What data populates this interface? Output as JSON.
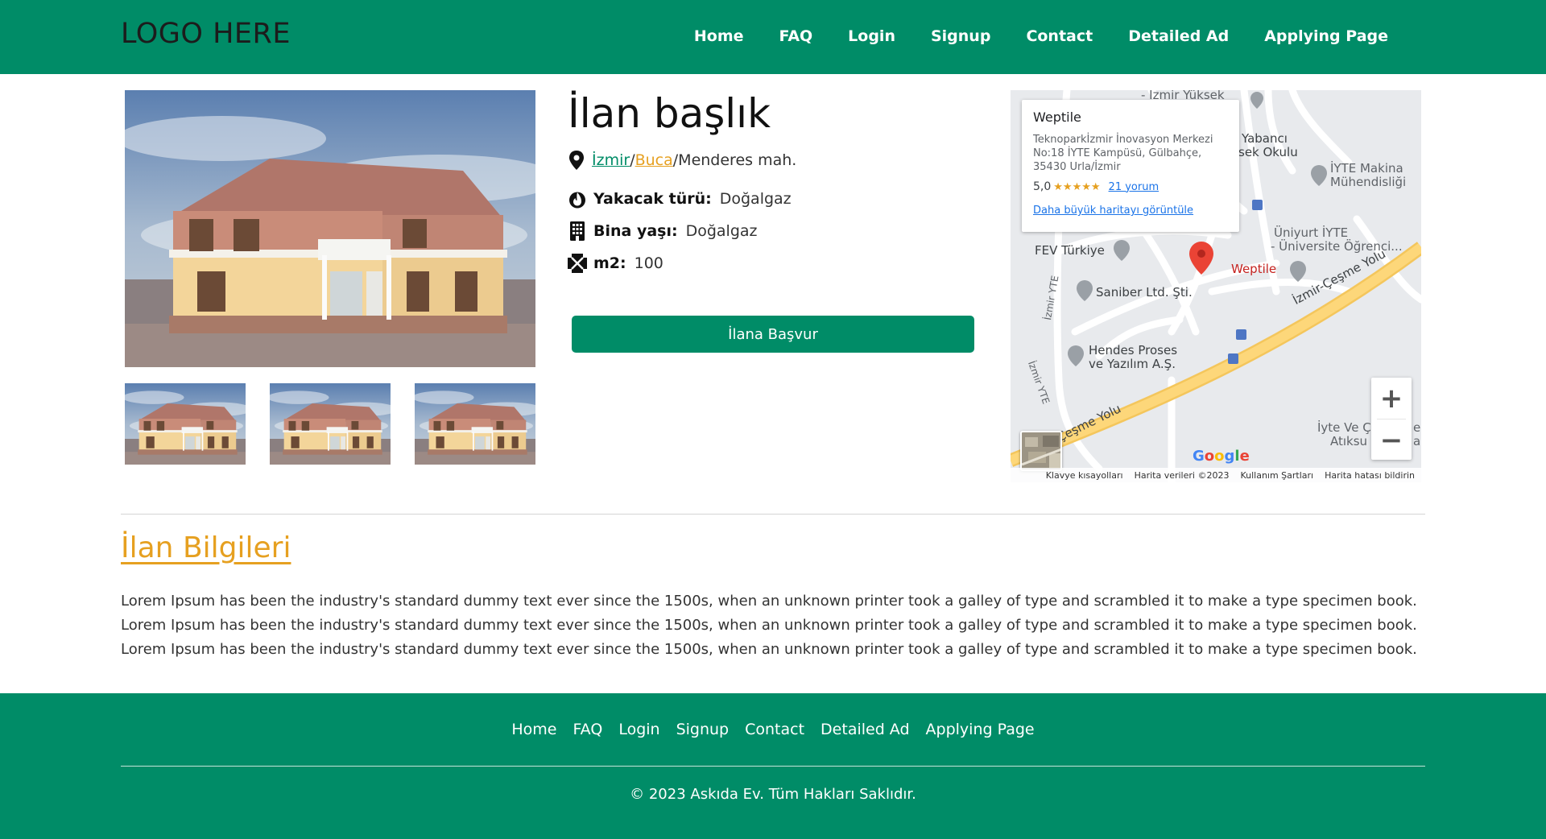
{
  "header": {
    "logo": "LOGO HERE",
    "nav": [
      "Home",
      "FAQ",
      "Login",
      "Signup",
      "Contact",
      "Detailed Ad",
      "Applying Page"
    ]
  },
  "listing": {
    "title": "İlan başlık",
    "location": {
      "city": "İzmir",
      "district": "Buca",
      "separator": "/",
      "neighborhood": "Menderes mah."
    },
    "attributes": [
      {
        "icon": "fire-icon",
        "label": "Yakacak türü:",
        "value": "Doğalgaz"
      },
      {
        "icon": "building-icon",
        "label": "Bina yaşı:",
        "value": "Doğalgaz"
      },
      {
        "icon": "area-icon",
        "label": "m2:",
        "value": "100"
      }
    ],
    "apply_label": "İlana Başvur"
  },
  "map": {
    "card": {
      "title": "Weptile",
      "address_lines": [
        "Teknoparkİzmir İnovasyon Merkezi",
        "No:18 İYTE Kampüsü, Gülbahçe,",
        "35430 Urla/İzmir"
      ],
      "rating": "5,0",
      "stars": "★★★★★",
      "reviews": "21 yorum",
      "link": "Daha büyük haritayı görüntüle"
    },
    "labels": {
      "top": "- İzmir Yüksek",
      "yabanci1": "Yabancı",
      "yabanci2": "sek Okulu",
      "iyte1": "İYTE Makina",
      "iyte2": "Mühendisliği",
      "uniyurt1": "Üniyurt İYTE",
      "uniyurt2": "- Üniversite Öğrenci...",
      "fev": "FEV Türkiye",
      "weptile": "Weptile",
      "saniber": "Saniber Ltd. Şti.",
      "hendes1": "Hendes Proses",
      "hendes2": "ve Yazılım A.Ş.",
      "cesme_road": "İzmir-Çeşme Yolu",
      "cesme_road2": "Çeşme Yolu",
      "iyte_road": "İzmir YTE",
      "iyte_road2": "İzmir YTE",
      "iyte_ve1": "İyte Ve Ç",
      "iyte_ve2": "Atıksu",
      "edge1": "er",
      "edge2": "a"
    },
    "zoom_in": "+",
    "zoom_out": "−",
    "google": [
      "G",
      "o",
      "o",
      "g",
      "l",
      "e"
    ],
    "attribution": [
      "Klavye kısayolları",
      "Harita verileri ©2023",
      "Kullanım Şartları",
      "Harita hatası bildirin"
    ],
    "colors": {
      "pin": "#ea4335",
      "road": "#fdd77a",
      "google_blue": "#4285f4",
      "google_red": "#ea4335",
      "google_yellow": "#fbbc05",
      "google_green": "#34a853"
    }
  },
  "info": {
    "title": "İlan Bilgileri",
    "text": "Lorem Ipsum has been the industry's standard dummy text ever since the 1500s, when an unknown printer took a galley of type and scrambled it to make a type specimen book. Lorem Ipsum has been the industry's standard dummy text ever since the 1500s, when an unknown printer took a galley of type and scrambled it to make a type specimen book. Lorem Ipsum has been the industry's standard dummy text ever since the 1500s, when an unknown printer took a galley of type and scrambled it to make a type specimen book."
  },
  "footer": {
    "nav": [
      "Home",
      "FAQ",
      "Login",
      "Signup",
      "Contact",
      "Detailed Ad",
      "Applying Page"
    ],
    "copyright": "© 2023 Askıda Ev. Tüm Hakları Saklıdır."
  },
  "colors": {
    "primary": "#008c67",
    "accent": "#e6a020"
  }
}
